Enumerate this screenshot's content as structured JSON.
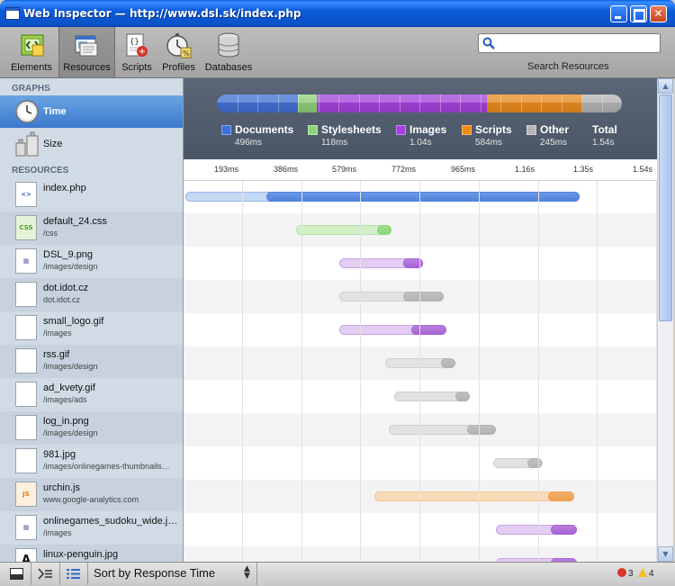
{
  "window": {
    "title": "Web Inspector — http://www.dsl.sk/index.php"
  },
  "toolbar": {
    "buttons": [
      {
        "label": "Elements",
        "icon": "elements-icon"
      },
      {
        "label": "Resources",
        "icon": "resources-icon"
      },
      {
        "label": "Scripts",
        "icon": "scripts-icon"
      },
      {
        "label": "Profiles",
        "icon": "profiles-icon"
      },
      {
        "label": "Databases",
        "icon": "databases-icon"
      }
    ],
    "active": "Resources",
    "search_label": "Search Resources",
    "search_value": ""
  },
  "sidebar": {
    "graphs_header": "GRAPHS",
    "graphs": [
      {
        "label": "Time",
        "icon": "clock-icon",
        "selected": true
      },
      {
        "label": "Size",
        "icon": "weights-icon",
        "selected": false
      }
    ],
    "resources_header": "RESOURCES",
    "resources": [
      {
        "name": "index.php",
        "path": "",
        "type": "document",
        "icon": "html-file-icon"
      },
      {
        "name": "default_24.css",
        "path": "/css",
        "type": "stylesheet",
        "icon": "css-file-icon"
      },
      {
        "name": "DSL_9.png",
        "path": "/images/design",
        "type": "image",
        "icon": "image-file-icon"
      },
      {
        "name": "dot.idot.cz",
        "path": "dot.idot.cz",
        "type": "other",
        "icon": "file-icon"
      },
      {
        "name": "small_logo.gif",
        "path": "/images",
        "type": "image",
        "icon": "file-icon"
      },
      {
        "name": "rss.gif",
        "path": "/images/design",
        "type": "other",
        "icon": "file-icon"
      },
      {
        "name": "ad_kvety.gif",
        "path": "/images/ads",
        "type": "other",
        "icon": "file-icon"
      },
      {
        "name": "log_in.png",
        "path": "/images/design",
        "type": "other",
        "icon": "file-icon"
      },
      {
        "name": "981.jpg",
        "path": "/images/onlinegames-thumbnails…",
        "type": "other",
        "icon": "file-icon"
      },
      {
        "name": "urchin.js",
        "path": "www.google-analytics.com",
        "type": "script",
        "icon": "js-file-icon"
      },
      {
        "name": "onlinegames_sudoku_wide.jpg",
        "path": "/images",
        "type": "image",
        "icon": "image-file-icon"
      },
      {
        "name": "linux-penguin.jpg",
        "path": "",
        "type": "image",
        "icon": "penguin-file-icon"
      }
    ]
  },
  "summary": {
    "categories": [
      {
        "name": "Documents",
        "value": "496ms",
        "ms": 496,
        "color": "#3d6fd8"
      },
      {
        "name": "Stylesheets",
        "value": "118ms",
        "ms": 118,
        "color": "#8fd47a"
      },
      {
        "name": "Images",
        "value": "1.04s",
        "ms": 1040,
        "color": "#a43ee0"
      },
      {
        "name": "Scripts",
        "value": "584ms",
        "ms": 584,
        "color": "#ef8a17"
      },
      {
        "name": "Other",
        "value": "245ms",
        "ms": 245,
        "color": "#b6b6b6"
      }
    ],
    "total": {
      "name": "Total",
      "value": "1.54s"
    }
  },
  "timeline": {
    "ticks": [
      "193ms",
      "386ms",
      "579ms",
      "772ms",
      "965ms",
      "1.16s",
      "1.35s",
      "1.54s"
    ],
    "max_ms": 1544,
    "type_colors": {
      "document": [
        "#c5d9f5",
        "#4e82dd"
      ],
      "stylesheet": [
        "#d2f0c8",
        "#8fd47a"
      ],
      "image": [
        "#e3cdf2",
        "#a863d6"
      ],
      "script": [
        "#f8dcb9",
        "#f0a050"
      ],
      "other": [
        "#e2e2e2",
        "#b3b3b3"
      ]
    },
    "rows": [
      {
        "start": 0,
        "resp": 140,
        "end": 680
      },
      {
        "start": 190,
        "resp": 330,
        "end": 355
      },
      {
        "start": 265,
        "resp": 375,
        "end": 410
      },
      {
        "start": 265,
        "resp": 375,
        "end": 445
      },
      {
        "start": 265,
        "resp": 390,
        "end": 450
      },
      {
        "start": 345,
        "resp": 440,
        "end": 465
      },
      {
        "start": 360,
        "resp": 465,
        "end": 490
      },
      {
        "start": 350,
        "resp": 485,
        "end": 535
      },
      {
        "start": 530,
        "resp": 590,
        "end": 615
      },
      {
        "start": 325,
        "resp": 625,
        "end": 670
      },
      {
        "start": 535,
        "resp": 630,
        "end": 675
      },
      {
        "start": 535,
        "resp": 630,
        "end": 675
      }
    ]
  },
  "statusbar": {
    "sort_label": "Sort by Response Time",
    "errors": "3",
    "warnings": "4"
  }
}
